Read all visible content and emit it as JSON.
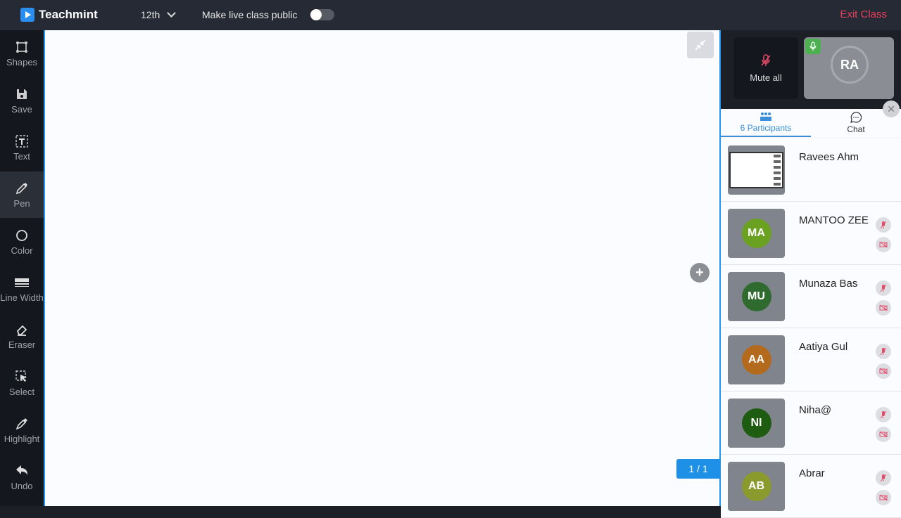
{
  "header": {
    "app_name": "Teachmint",
    "grade": "12th",
    "public_label": "Make live class public",
    "public_enabled": false,
    "exit_label": "Exit Class"
  },
  "toolbar": {
    "items": [
      {
        "label": "Shapes",
        "icon": "shapes-icon"
      },
      {
        "label": "Save",
        "icon": "save-icon"
      },
      {
        "label": "Text",
        "icon": "text-icon"
      },
      {
        "label": "Pen",
        "icon": "pen-icon",
        "active": true
      },
      {
        "label": "Color",
        "icon": "color-icon"
      },
      {
        "label": "Line Width",
        "icon": "line-width-icon"
      },
      {
        "label": "Eraser",
        "icon": "eraser-icon"
      },
      {
        "label": "Select",
        "icon": "select-icon"
      },
      {
        "label": "Highlight",
        "icon": "highlight-icon"
      },
      {
        "label": "Undo",
        "icon": "undo-icon"
      }
    ]
  },
  "canvas": {
    "page_indicator": "1 / 1"
  },
  "controls": {
    "mute_all_label": "Mute all",
    "self_initials": "RA"
  },
  "panel": {
    "tabs": {
      "participants": "6 Participants",
      "chat": "Chat"
    },
    "participants": [
      {
        "name": "Ravees Ahm",
        "initials": "",
        "color": "",
        "screen": true
      },
      {
        "name": "MANTOO ZEE",
        "initials": "MA",
        "color": "#6aa121"
      },
      {
        "name": "Munaza Bas",
        "initials": "MU",
        "color": "#2f6b2f"
      },
      {
        "name": "Aatiya Gul",
        "initials": "AA",
        "color": "#b36a1c"
      },
      {
        "name": "Niha@",
        "initials": "NI",
        "color": "#1e5c12"
      },
      {
        "name": "Abrar",
        "initials": "AB",
        "color": "#8a9a2c"
      }
    ]
  },
  "colors": {
    "accent": "#2196f3",
    "exit": "#e83e5a",
    "muted_icon": "#e84a6a",
    "active_mic": "#4caf50"
  }
}
